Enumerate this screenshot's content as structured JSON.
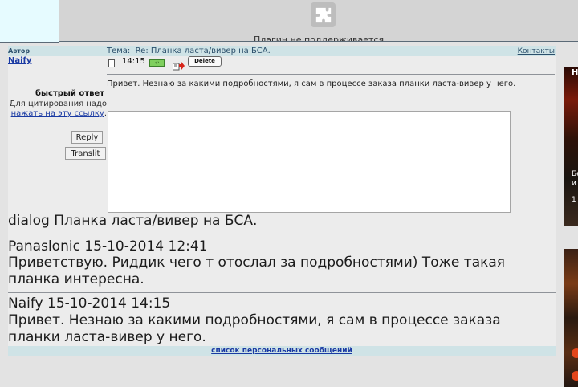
{
  "plugin": {
    "message": "Плагин не поддерживается"
  },
  "header": {
    "author_label": "Автор",
    "topic_prefix": "Тема:",
    "topic_title": "Re: Планка ласта/вивер на БСА.",
    "contacts_link": "Контакты"
  },
  "message": {
    "author": "Naify",
    "time": "14:15",
    "delete_label": "Delete",
    "body": "Привет. Незнаю за какими подробностями, я сам в процессе заказа планки ласта-вивер у него."
  },
  "quick_reply": {
    "title": "быстрый ответ",
    "hint_text": "Для цитирования надо",
    "hint_link": "нажать на эту ссылку",
    "hint_end": ".",
    "reply_button": "Reply",
    "translit_button": "Translit",
    "textarea_value": ""
  },
  "dialog": {
    "title": "dialog Планка ласта/вивер на БСА.",
    "posts": [
      {
        "author": "Panaslonic",
        "datetime": "15-10-2014 12:41",
        "header": "Panaslonic 15-10-2014 12:41",
        "text": "Приветствую. Риддик чего т отослал за подробностями) Тоже такая планка интересна."
      },
      {
        "author": "Naify",
        "datetime": "15-10-2014 14:15",
        "header": "Naify 15-10-2014 14:15",
        "text": "Привет. Незнаю за какими подробностями, я сам в процессе заказа планки ласта-вивер у него."
      }
    ]
  },
  "footer": {
    "link": "список персональных сообщений"
  },
  "ads": {
    "ad1_lines": [
      "Н",
      "Бе",
      "и",
      "1"
    ]
  },
  "colors": {
    "header_bg": "#cfe3e6",
    "link": "#1a3aa3",
    "page_bg": "#e3e3e3"
  }
}
